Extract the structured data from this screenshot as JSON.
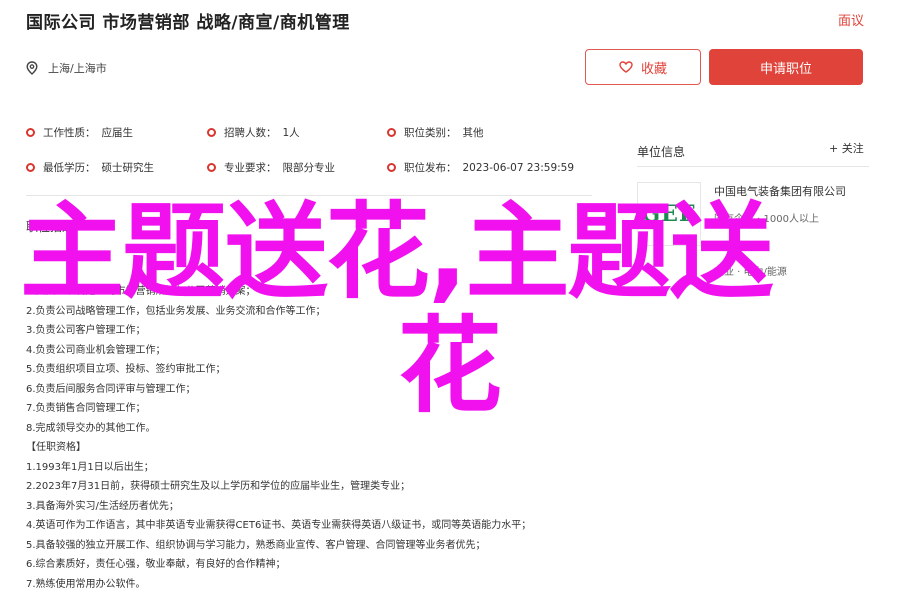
{
  "header": {
    "title": "国际公司 市场营销部 战略/商宣/商机管理",
    "report": "面议",
    "location": "上海/上海市",
    "favorite_label": "收藏",
    "apply_label": "申请职位",
    "accent_color": "#e0433a"
  },
  "attributes": [
    {
      "label": "工作性质：",
      "value": "应届生"
    },
    {
      "label": "招聘人数：",
      "value": "1人"
    },
    {
      "label": "职位类别：",
      "value": "其他"
    },
    {
      "label": "最低学历：",
      "value": "硕士研究生"
    },
    {
      "label": "专业要求：",
      "value": "限部分专业"
    },
    {
      "label": "职位发布：",
      "value": "2023-06-07 23:59:59"
    }
  ],
  "description": {
    "title": "职位描述",
    "lines": [
      "1.负责组织制定公司市场营销规划与公司营销方案；",
      "2.负责公司战略管理工作，包括业务发展、业务交流和合作等工作；",
      "3.负责公司客户管理工作；",
      "4.负责公司商业机会管理工作；",
      "5.负责组织项目立项、投标、签约审批工作；",
      "6.负责后间服务合同评审与管理工作；",
      "7.负责销售合同管理工作；",
      "8.完成领导交办的其他工作。",
      "【任职资格】",
      "1.1993年1月1日以后出生；",
      "2.2023年7月31日前，获得硕士研究生及以上学历和学位的应届毕业生，管理类专业；",
      "3.具备海外实习/生活经历者优先；",
      "4.英语可作为工作语言，其中非英语专业需获得CET6证书、英语专业需获得英语八级证书，或同等英语能力水平；",
      "5.具备较强的独立开展工作、组织协调与学习能力，熟悉商业宣传、客户管理、合同管理等业务者优先；",
      "6.综合素质好，责任心强，敬业奉献，有良好的合作精神；",
      "7.熟练使用常用办公软件。"
    ]
  },
  "sidebar": {
    "title": "单位信息",
    "follow": "+ 关注",
    "company_name": "中国电气装备集团有限公司",
    "logo_text": "GEE",
    "meta1": "国有企业 · 1000人以上",
    "meta2": "企业 · 电力/能源"
  },
  "overlay": {
    "line1": "主题送花,主题送",
    "line2": "花",
    "color": "#f011ee"
  }
}
